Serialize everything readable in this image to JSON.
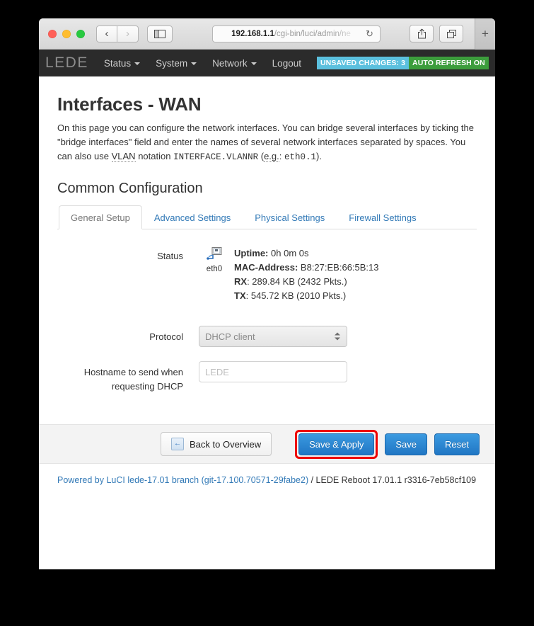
{
  "browser": {
    "traffic_lights": [
      "close",
      "minimize",
      "zoom"
    ],
    "back_label": "‹",
    "forward_label": "›",
    "sidebar_icon": "sidebar-icon",
    "url_host": "192.168.1.1",
    "url_path": "/cgi-bin/luci/admin/ne",
    "reload_glyph": "↻",
    "share_glyph": "⇧",
    "tabs_glyph": "⧉",
    "newtab_label": "+"
  },
  "luci_nav": {
    "brand": "LEDE",
    "items": [
      {
        "label": "Status",
        "has_caret": true
      },
      {
        "label": "System",
        "has_caret": true
      },
      {
        "label": "Network",
        "has_caret": true
      },
      {
        "label": "Logout",
        "has_caret": false
      }
    ],
    "badges": {
      "unsaved": "UNSAVED CHANGES: 3",
      "unsaved_color": "#5bc0de",
      "refresh": "AUTO REFRESH ON",
      "refresh_color": "#3c9d3c"
    }
  },
  "page": {
    "title": "Interfaces - WAN",
    "desc_part1": "On this page you can configure the network interfaces. You can bridge several interfaces by ticking the \"bridge interfaces\" field and enter the names of several network interfaces separated by spaces. You can also use ",
    "desc_vlan": "VLAN",
    "desc_part2": " notation ",
    "desc_code1": "INTERFACE.VLANNR",
    "desc_part3": " (",
    "desc_eg": "e.g.",
    "desc_part4": ": ",
    "desc_code2": "eth0.1",
    "desc_part5": ").",
    "section_title": "Common Configuration"
  },
  "tabs": [
    {
      "label": "General Setup",
      "active": true
    },
    {
      "label": "Advanced Settings",
      "active": false
    },
    {
      "label": "Physical Settings",
      "active": false
    },
    {
      "label": "Firewall Settings",
      "active": false
    }
  ],
  "form": {
    "status": {
      "label": "Status",
      "interface_icon": "ethernet-icon",
      "interface_name": "eth0",
      "uptime_key": "Uptime:",
      "uptime_value": "0h 0m 0s",
      "mac_key": "MAC-Address:",
      "mac_value": "B8:27:EB:66:5B:13",
      "rx_key": "RX",
      "rx_value": ": 289.84 KB (2432 Pkts.)",
      "tx_key": "TX",
      "tx_value": ": 545.72 KB (2010 Pkts.)"
    },
    "protocol": {
      "label": "Protocol",
      "value": "DHCP client",
      "options": [
        "DHCP client"
      ]
    },
    "hostname": {
      "label_line1": "Hostname to send when",
      "label_line2": "requesting DHCP",
      "value": "",
      "placeholder": "LEDE"
    }
  },
  "buttons": {
    "back": "Back to Overview",
    "back_icon": "←",
    "save_apply": "Save & Apply",
    "save": "Save",
    "reset": "Reset",
    "highlight_color": "#ee0000",
    "primary_color": "#2076c4"
  },
  "footer": {
    "link_text": "Powered by LuCI lede-17.01 branch (git-17.100.70571-29fabe2)",
    "suffix": " / LEDE Reboot 17.01.1 r3316-7eb58cf109"
  }
}
